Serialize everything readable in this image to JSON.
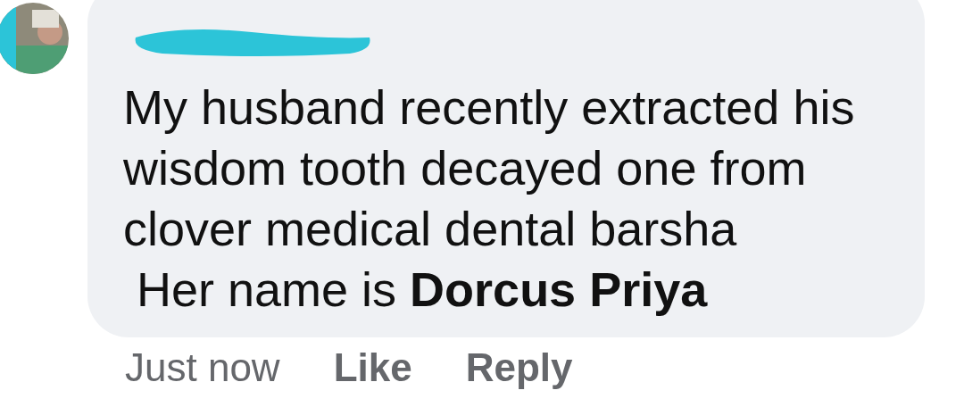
{
  "comment": {
    "name_redacted": true,
    "lines": [
      "My husband recently extracted his",
      "wisdom tooth decayed one from",
      "clover medical dental barsha",
      " Her name is **Dorcus Priya**"
    ]
  },
  "actions": [
    {
      "kind": "time",
      "label": "Just now"
    },
    {
      "kind": "action",
      "label": "Like"
    },
    {
      "kind": "action",
      "label": "Reply"
    }
  ]
}
